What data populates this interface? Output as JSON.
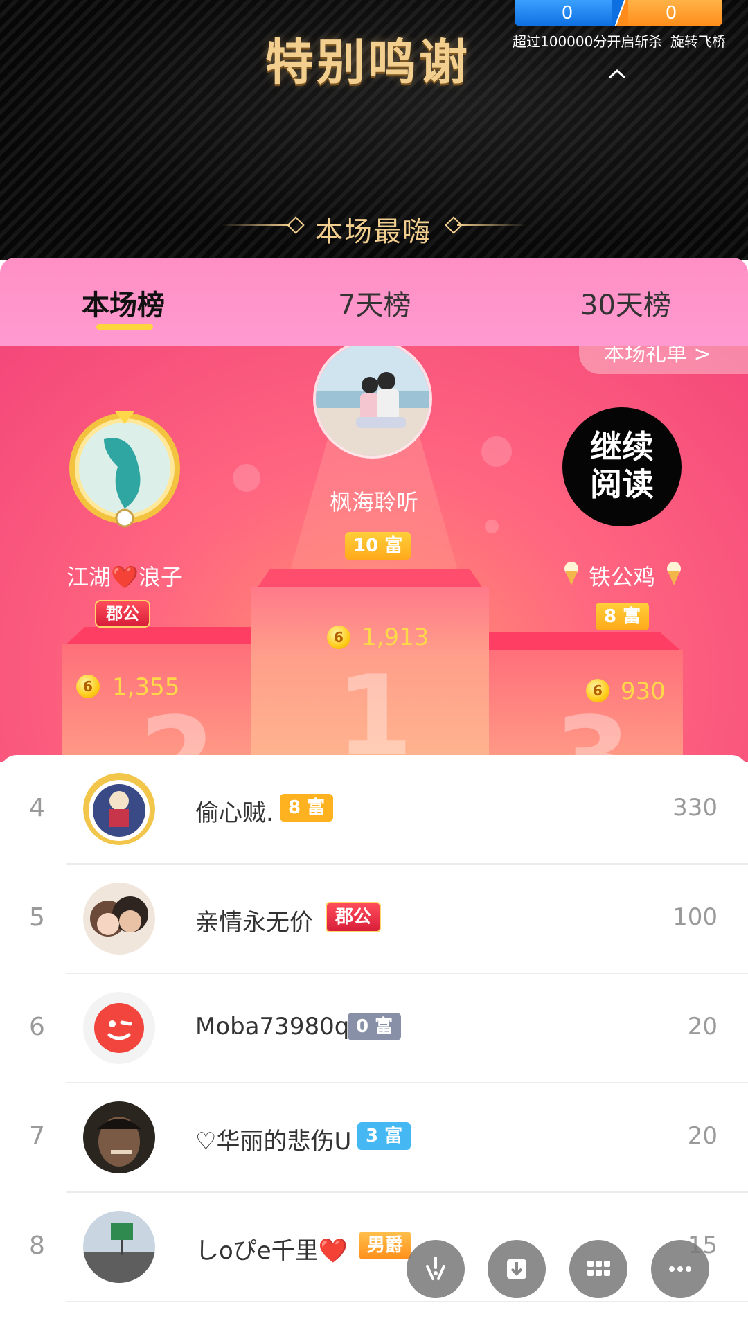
{
  "header": {
    "title": "特别鸣谢",
    "subtitle": "本场最嗨",
    "progress": {
      "left_value": "0",
      "right_value": "0"
    },
    "tip_left": "超过100000分开启斩杀",
    "tip_right": "旋转飞桥"
  },
  "tabs": [
    {
      "label": "本场榜",
      "active": true
    },
    {
      "label": "7天榜",
      "active": false
    },
    {
      "label": "30天榜",
      "active": false
    }
  ],
  "gift_link": "本场礼单 >",
  "podium": {
    "first": {
      "name": "枫海聆听",
      "badge": "10 富",
      "coins": "1,913"
    },
    "second": {
      "name": "江湖❤️浪子",
      "badge": "郡公",
      "coins": "1,355"
    },
    "third": {
      "name": "铁公鸡",
      "badge": "8 富",
      "coins": "930",
      "avatar_text": "继续\n阅读"
    }
  },
  "rows": [
    {
      "rank": "4",
      "name": "偷心贼.",
      "badge": "8 富",
      "badge_color": "#ffb21f",
      "score": "330"
    },
    {
      "rank": "5",
      "name": "亲情永无价",
      "badge": "郡公",
      "badge_color": "#e0283d",
      "score": "100"
    },
    {
      "rank": "6",
      "name": "Moba73980q",
      "badge": "0 富",
      "badge_color": "#8890a8",
      "score": "20"
    },
    {
      "rank": "7",
      "name": "♡华丽的悲伤U",
      "badge": "3 富",
      "badge_color": "#45b7f2",
      "score": "20"
    },
    {
      "rank": "8",
      "name": "しoぴe千里❤️",
      "badge": "男爵",
      "badge_color": "#ff9d1a",
      "score": "15"
    }
  ],
  "fab_icons": [
    "sparkle-icon",
    "download-icon",
    "grid-icon",
    "more-icon"
  ]
}
